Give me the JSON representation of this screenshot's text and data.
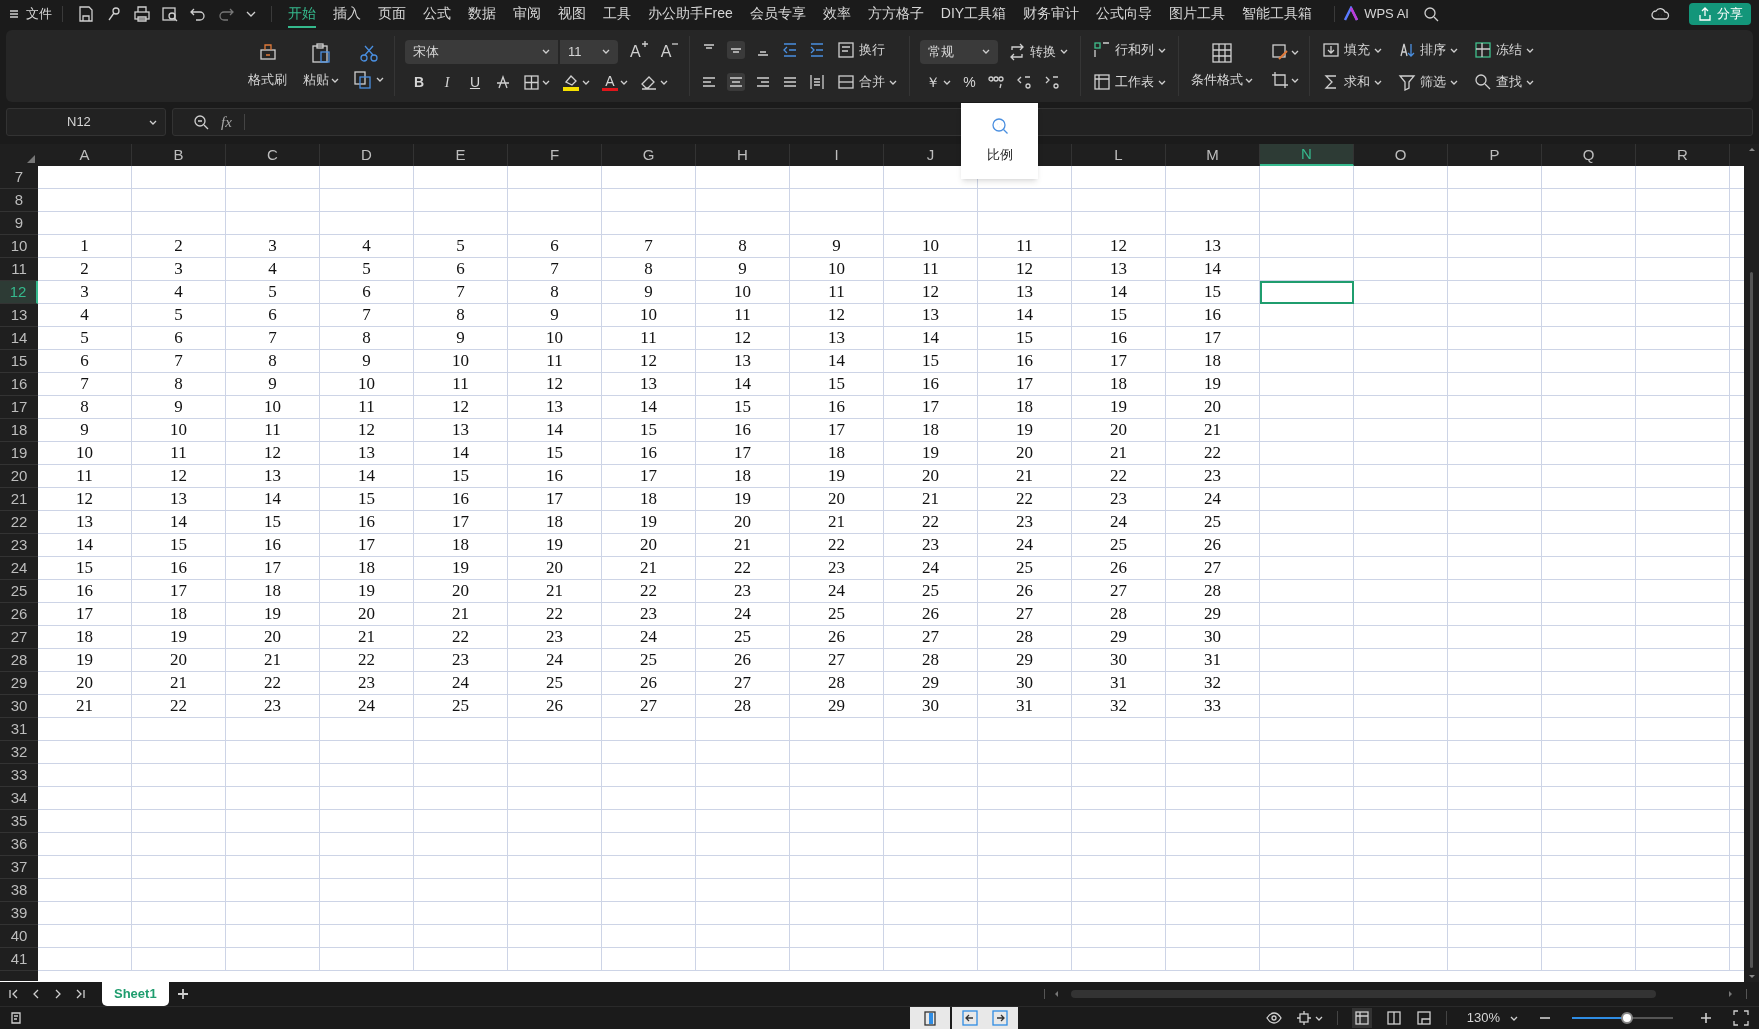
{
  "menu": {
    "file": "文件",
    "tabs": [
      {
        "label": "开始",
        "selected": true
      },
      {
        "label": "插入",
        "selected": false
      },
      {
        "label": "页面",
        "selected": false
      },
      {
        "label": "公式",
        "selected": false
      },
      {
        "label": "数据",
        "selected": false
      },
      {
        "label": "审阅",
        "selected": false
      },
      {
        "label": "视图",
        "selected": false
      },
      {
        "label": "工具",
        "selected": false
      },
      {
        "label": "办公助手Free",
        "selected": false
      },
      {
        "label": "会员专享",
        "selected": false
      },
      {
        "label": "效率",
        "selected": false
      },
      {
        "label": "方方格子",
        "selected": false
      },
      {
        "label": "DIY工具箱",
        "selected": false
      },
      {
        "label": "财务审计",
        "selected": false
      },
      {
        "label": "公式向导",
        "selected": false
      },
      {
        "label": "图片工具",
        "selected": false
      },
      {
        "label": "智能工具箱",
        "selected": false
      }
    ],
    "wps_ai": "WPS AI",
    "share": "分享"
  },
  "ribbon": {
    "format_painter": "格式刷",
    "paste": "粘贴",
    "font": "宋体",
    "font_size": "11",
    "grow_font": "A",
    "shrink_font": "A",
    "bold": "B",
    "italic": "I",
    "underline": "U",
    "font_color": "A",
    "wrap": "换行",
    "merge": "合并",
    "number_format": "常规",
    "convert": "转换",
    "currency": "￥",
    "percent": "%",
    "rows_cols": "行和列",
    "worksheet": "工作表",
    "cond_format": "条件格式",
    "fill": "填充",
    "sort": "排序",
    "freeze": "冻结",
    "sum": "求和",
    "filter": "筛选",
    "find": "查找"
  },
  "name_box": "N12",
  "formula_label": "fx",
  "popup": {
    "label": "比例"
  },
  "columns": [
    {
      "label": "A",
      "selected": false
    },
    {
      "label": "B",
      "selected": false
    },
    {
      "label": "C",
      "selected": false
    },
    {
      "label": "D",
      "selected": false
    },
    {
      "label": "E",
      "selected": false
    },
    {
      "label": "F",
      "selected": false
    },
    {
      "label": "G",
      "selected": false
    },
    {
      "label": "H",
      "selected": false
    },
    {
      "label": "I",
      "selected": false
    },
    {
      "label": "J",
      "selected": false
    },
    {
      "selected": false
    },
    {
      "label": "L",
      "selected": false
    },
    {
      "label": "M",
      "selected": false
    },
    {
      "label": "N",
      "selected": true
    },
    {
      "label": "O",
      "selected": false
    },
    {
      "label": "P",
      "selected": false
    },
    {
      "label": "Q",
      "selected": false
    },
    {
      "label": "R",
      "selected": false
    }
  ],
  "rows": [
    {
      "label": "7",
      "selected": false
    },
    {
      "label": "8",
      "selected": false
    },
    {
      "label": "9",
      "selected": false
    },
    {
      "label": "10",
      "selected": false,
      "cells": [
        "1",
        "2",
        "3",
        "4",
        "5",
        "6",
        "7",
        "8",
        "9",
        "10",
        "11",
        "12",
        "13"
      ]
    },
    {
      "label": "11",
      "selected": false,
      "cells": [
        "2",
        "3",
        "4",
        "5",
        "6",
        "7",
        "8",
        "9",
        "10",
        "11",
        "12",
        "13",
        "14"
      ]
    },
    {
      "label": "12",
      "selected": true,
      "cells": [
        "3",
        "4",
        "5",
        "6",
        "7",
        "8",
        "9",
        "10",
        "11",
        "12",
        "13",
        "14",
        "15"
      ]
    },
    {
      "label": "13",
      "selected": false,
      "cells": [
        "4",
        "5",
        "6",
        "7",
        "8",
        "9",
        "10",
        "11",
        "12",
        "13",
        "14",
        "15",
        "16"
      ]
    },
    {
      "label": "14",
      "selected": false,
      "cells": [
        "5",
        "6",
        "7",
        "8",
        "9",
        "10",
        "11",
        "12",
        "13",
        "14",
        "15",
        "16",
        "17"
      ]
    },
    {
      "label": "15",
      "selected": false,
      "cells": [
        "6",
        "7",
        "8",
        "9",
        "10",
        "11",
        "12",
        "13",
        "14",
        "15",
        "16",
        "17",
        "18"
      ]
    },
    {
      "label": "16",
      "selected": false,
      "cells": [
        "7",
        "8",
        "9",
        "10",
        "11",
        "12",
        "13",
        "14",
        "15",
        "16",
        "17",
        "18",
        "19"
      ]
    },
    {
      "label": "17",
      "selected": false,
      "cells": [
        "8",
        "9",
        "10",
        "11",
        "12",
        "13",
        "14",
        "15",
        "16",
        "17",
        "18",
        "19",
        "20"
      ]
    },
    {
      "label": "18",
      "selected": false,
      "cells": [
        "9",
        "10",
        "11",
        "12",
        "13",
        "14",
        "15",
        "16",
        "17",
        "18",
        "19",
        "20",
        "21"
      ]
    },
    {
      "label": "19",
      "selected": false,
      "cells": [
        "10",
        "11",
        "12",
        "13",
        "14",
        "15",
        "16",
        "17",
        "18",
        "19",
        "20",
        "21",
        "22"
      ]
    },
    {
      "label": "20",
      "selected": false,
      "cells": [
        "11",
        "12",
        "13",
        "14",
        "15",
        "16",
        "17",
        "18",
        "19",
        "20",
        "21",
        "22",
        "23"
      ]
    },
    {
      "label": "21",
      "selected": false,
      "cells": [
        "12",
        "13",
        "14",
        "15",
        "16",
        "17",
        "18",
        "19",
        "20",
        "21",
        "22",
        "23",
        "24"
      ]
    },
    {
      "label": "22",
      "selected": false,
      "cells": [
        "13",
        "14",
        "15",
        "16",
        "17",
        "18",
        "19",
        "20",
        "21",
        "22",
        "23",
        "24",
        "25"
      ]
    },
    {
      "label": "23",
      "selected": false,
      "cells": [
        "14",
        "15",
        "16",
        "17",
        "18",
        "19",
        "20",
        "21",
        "22",
        "23",
        "24",
        "25",
        "26"
      ]
    },
    {
      "label": "24",
      "selected": false,
      "cells": [
        "15",
        "16",
        "17",
        "18",
        "19",
        "20",
        "21",
        "22",
        "23",
        "24",
        "25",
        "26",
        "27"
      ]
    },
    {
      "label": "25",
      "selected": false,
      "cells": [
        "16",
        "17",
        "18",
        "19",
        "20",
        "21",
        "22",
        "23",
        "24",
        "25",
        "26",
        "27",
        "28"
      ]
    },
    {
      "label": "26",
      "selected": false,
      "cells": [
        "17",
        "18",
        "19",
        "20",
        "21",
        "22",
        "23",
        "24",
        "25",
        "26",
        "27",
        "28",
        "29"
      ]
    },
    {
      "label": "27",
      "selected": false,
      "cells": [
        "18",
        "19",
        "20",
        "21",
        "22",
        "23",
        "24",
        "25",
        "26",
        "27",
        "28",
        "29",
        "30"
      ]
    },
    {
      "label": "28",
      "selected": false,
      "cells": [
        "19",
        "20",
        "21",
        "22",
        "23",
        "24",
        "25",
        "26",
        "27",
        "28",
        "29",
        "30",
        "31"
      ]
    },
    {
      "label": "29",
      "selected": false,
      "cells": [
        "20",
        "21",
        "22",
        "23",
        "24",
        "25",
        "26",
        "27",
        "28",
        "29",
        "30",
        "31",
        "32"
      ]
    },
    {
      "label": "30",
      "selected": false,
      "cells": [
        "21",
        "22",
        "23",
        "24",
        "25",
        "26",
        "27",
        "28",
        "29",
        "30",
        "31",
        "32",
        "33"
      ]
    },
    {
      "label": "31",
      "selected": false
    },
    {
      "label": "32",
      "selected": false
    },
    {
      "label": "33",
      "selected": false
    },
    {
      "label": "34",
      "selected": false
    },
    {
      "label": "35",
      "selected": false
    },
    {
      "label": "36",
      "selected": false
    },
    {
      "label": "37",
      "selected": false
    },
    {
      "label": "38",
      "selected": false
    },
    {
      "label": "39",
      "selected": false
    },
    {
      "label": "40",
      "selected": false
    },
    {
      "label": "41",
      "selected": false
    }
  ],
  "sheets": [
    {
      "label": "Sheet1",
      "selected": true
    }
  ],
  "zoom": {
    "reading": "130%",
    "level": 0.54
  }
}
